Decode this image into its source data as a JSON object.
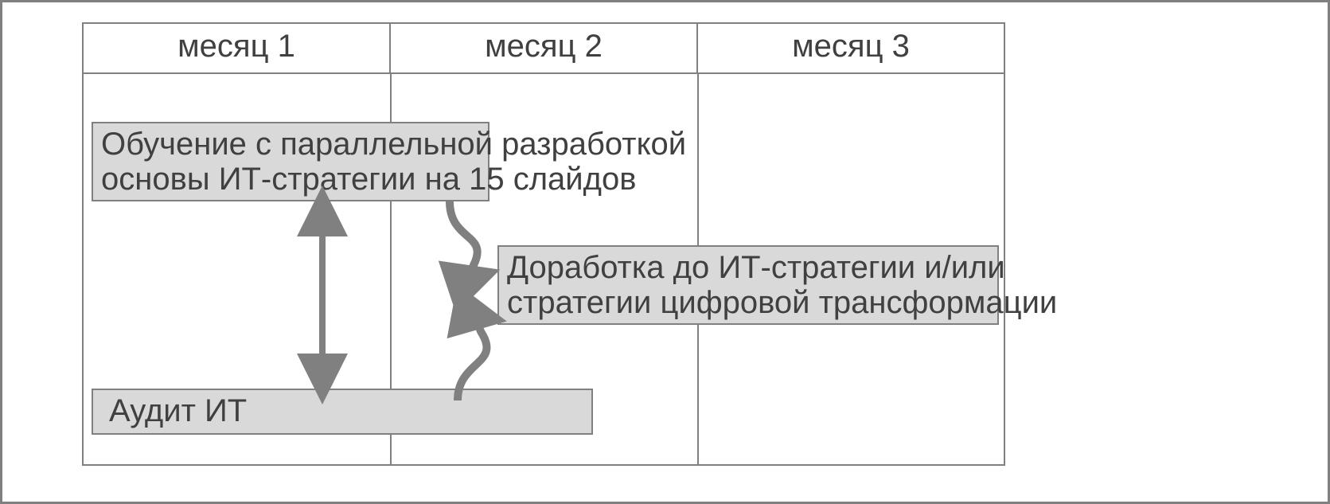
{
  "months": [
    "месяц 1",
    "месяц 2",
    "месяц 3"
  ],
  "tasks": {
    "training": {
      "line1": "Обучение с параллельной разработкой",
      "line2": "основы ИТ-стратегии на 15 слайдов"
    },
    "refine": {
      "line1": "Доработка до ИТ-стратегии и/или",
      "line2": "стратегии цифровой трансформации"
    },
    "audit": "Аудит ИТ"
  }
}
